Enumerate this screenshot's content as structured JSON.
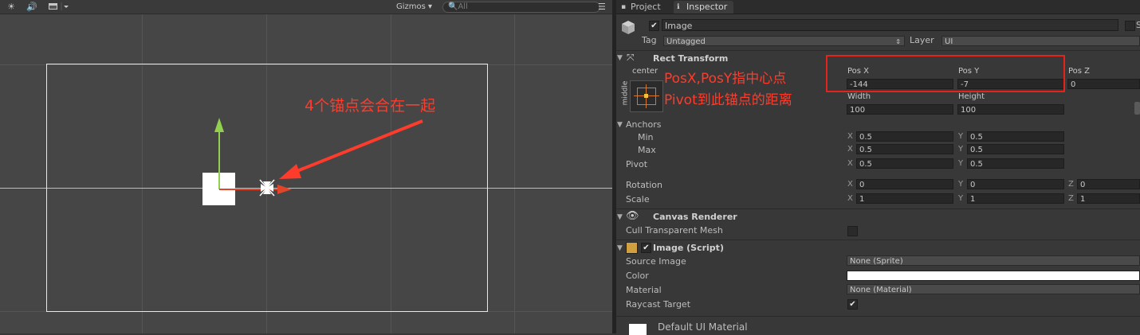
{
  "scene": {
    "toolbar": {
      "sun_icon": "sun-icon",
      "audio_icon": "audio-icon",
      "effects_icon": "image-effects-icon",
      "gizmos_label": "Gizmos",
      "search_placeholder": "All"
    },
    "annotation": "4个锚点会合在一起",
    "colors": {
      "annotation": "#ff3b2b",
      "arrow": "#ff3b2b",
      "move_x": "#e2462a",
      "move_y": "#92d050"
    }
  },
  "inspector": {
    "tabs": [
      {
        "label": "Project"
      },
      {
        "label": "Inspector"
      }
    ],
    "gameobject": {
      "name": "Image",
      "static_label": "S",
      "tag_label": "Tag",
      "tag_value": "Untagged",
      "layer_label": "Layer",
      "layer_value": "UI"
    },
    "rect_transform": {
      "header": "Rect Transform",
      "anchor_h": "center",
      "anchor_v": "middle",
      "posx_label": "Pos X",
      "posy_label": "Pos Y",
      "posz_label": "Pos Z",
      "posx": "-144",
      "posy": "-7",
      "posz": "0",
      "width_label": "Width",
      "height_label": "Height",
      "width": "100",
      "height": "100",
      "anchors_label": "Anchors",
      "min_label": "Min",
      "max_label": "Max",
      "pivot_label": "Pivot",
      "rotation_label": "Rotation",
      "scale_label": "Scale",
      "x": "X",
      "y": "Y",
      "z": "Z",
      "min_x": "0.5",
      "min_y": "0.5",
      "max_x": "0.5",
      "max_y": "0.5",
      "pivot_x": "0.5",
      "pivot_y": "0.5",
      "rot_x": "0",
      "rot_y": "0",
      "rot_z": "0",
      "scale_x": "1",
      "scale_y": "1",
      "scale_z": "1"
    },
    "canvas_renderer": {
      "header": "Canvas Renderer",
      "cull_label": "Cull Transparent Mesh"
    },
    "image_script": {
      "header": "Image (Script)",
      "source_label": "Source Image",
      "source_value": "None (Sprite)",
      "color_label": "Color",
      "color_value": "#ffffff",
      "material_label": "Material",
      "material_value": "None (Material)",
      "raycast_label": "Raycast Target"
    },
    "default_material": "Default UI Material",
    "annotation_line1": "PosX,PosY指中心点",
    "annotation_line2": "Pivot到此锚点的距离"
  }
}
